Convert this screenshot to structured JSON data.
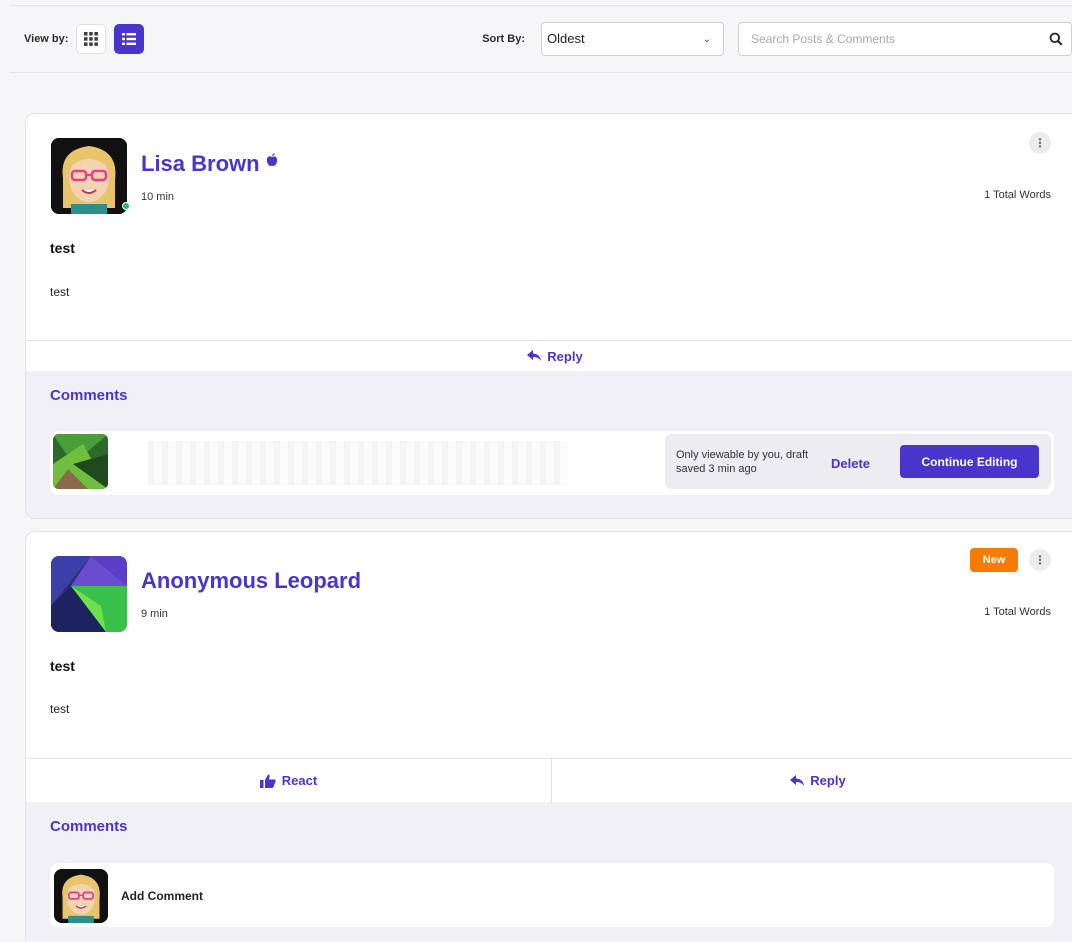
{
  "toolbar": {
    "view_by_label": "View by:",
    "sort_by_label": "Sort By:",
    "sort_selected": "Oldest",
    "search_placeholder": "Search Posts & Comments"
  },
  "posts": [
    {
      "author": "Lisa Brown",
      "time": "10 min",
      "words": "1 Total Words",
      "title": "test",
      "body": "test",
      "actions": [
        "Reply"
      ],
      "comments_title": "Comments",
      "draft": {
        "note": "Only viewable by you, draft saved 3 min ago",
        "delete_label": "Delete",
        "continue_label": "Continue Editing"
      }
    },
    {
      "author": "Anonymous Leopard",
      "badge": "New",
      "time": "9 min",
      "words": "1 Total Words",
      "title": "test",
      "body": "test",
      "actions": [
        "React",
        "Reply"
      ],
      "comments_title": "Comments",
      "add_comment_label": "Add Comment"
    }
  ],
  "colors": {
    "accent": "#4a35cc",
    "badge": "#f57c00"
  },
  "icons": {
    "grid_view": "grid-icon",
    "list_view": "list-icon",
    "search": "search-icon",
    "reply": "reply-icon",
    "react": "thumbs-up-icon",
    "more": "kebab-icon"
  }
}
